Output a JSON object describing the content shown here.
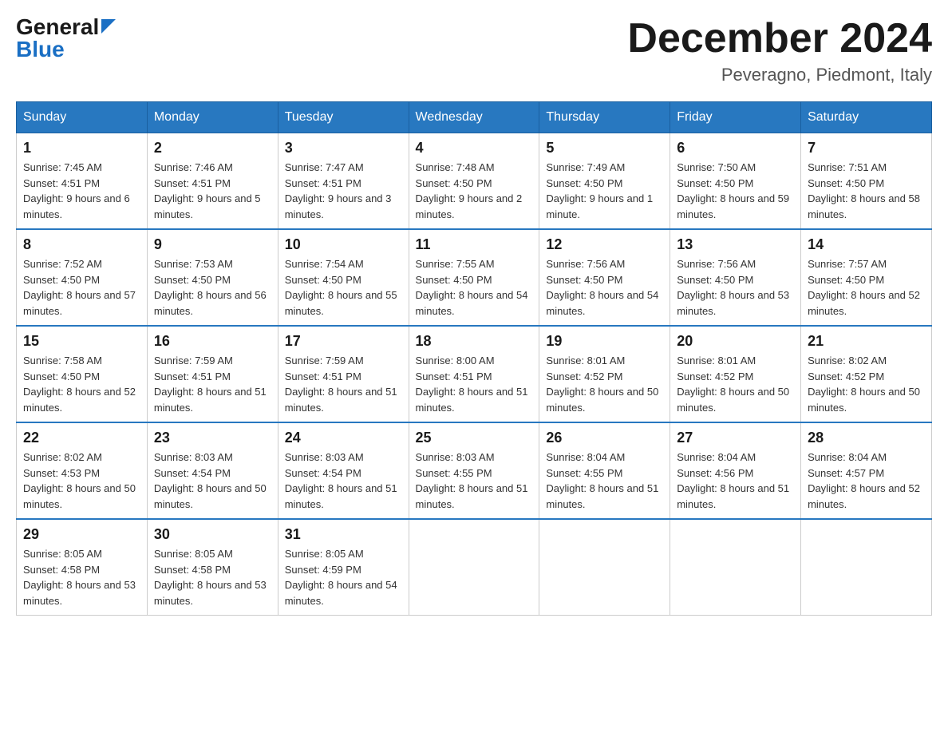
{
  "header": {
    "logo_general": "General",
    "logo_blue": "Blue",
    "month_title": "December 2024",
    "location": "Peveragno, Piedmont, Italy"
  },
  "days_of_week": [
    "Sunday",
    "Monday",
    "Tuesday",
    "Wednesday",
    "Thursday",
    "Friday",
    "Saturday"
  ],
  "weeks": [
    [
      {
        "day": "1",
        "sunrise": "7:45 AM",
        "sunset": "4:51 PM",
        "daylight": "9 hours and 6 minutes."
      },
      {
        "day": "2",
        "sunrise": "7:46 AM",
        "sunset": "4:51 PM",
        "daylight": "9 hours and 5 minutes."
      },
      {
        "day": "3",
        "sunrise": "7:47 AM",
        "sunset": "4:51 PM",
        "daylight": "9 hours and 3 minutes."
      },
      {
        "day": "4",
        "sunrise": "7:48 AM",
        "sunset": "4:50 PM",
        "daylight": "9 hours and 2 minutes."
      },
      {
        "day": "5",
        "sunrise": "7:49 AM",
        "sunset": "4:50 PM",
        "daylight": "9 hours and 1 minute."
      },
      {
        "day": "6",
        "sunrise": "7:50 AM",
        "sunset": "4:50 PM",
        "daylight": "8 hours and 59 minutes."
      },
      {
        "day": "7",
        "sunrise": "7:51 AM",
        "sunset": "4:50 PM",
        "daylight": "8 hours and 58 minutes."
      }
    ],
    [
      {
        "day": "8",
        "sunrise": "7:52 AM",
        "sunset": "4:50 PM",
        "daylight": "8 hours and 57 minutes."
      },
      {
        "day": "9",
        "sunrise": "7:53 AM",
        "sunset": "4:50 PM",
        "daylight": "8 hours and 56 minutes."
      },
      {
        "day": "10",
        "sunrise": "7:54 AM",
        "sunset": "4:50 PM",
        "daylight": "8 hours and 55 minutes."
      },
      {
        "day": "11",
        "sunrise": "7:55 AM",
        "sunset": "4:50 PM",
        "daylight": "8 hours and 54 minutes."
      },
      {
        "day": "12",
        "sunrise": "7:56 AM",
        "sunset": "4:50 PM",
        "daylight": "8 hours and 54 minutes."
      },
      {
        "day": "13",
        "sunrise": "7:56 AM",
        "sunset": "4:50 PM",
        "daylight": "8 hours and 53 minutes."
      },
      {
        "day": "14",
        "sunrise": "7:57 AM",
        "sunset": "4:50 PM",
        "daylight": "8 hours and 52 minutes."
      }
    ],
    [
      {
        "day": "15",
        "sunrise": "7:58 AM",
        "sunset": "4:50 PM",
        "daylight": "8 hours and 52 minutes."
      },
      {
        "day": "16",
        "sunrise": "7:59 AM",
        "sunset": "4:51 PM",
        "daylight": "8 hours and 51 minutes."
      },
      {
        "day": "17",
        "sunrise": "7:59 AM",
        "sunset": "4:51 PM",
        "daylight": "8 hours and 51 minutes."
      },
      {
        "day": "18",
        "sunrise": "8:00 AM",
        "sunset": "4:51 PM",
        "daylight": "8 hours and 51 minutes."
      },
      {
        "day": "19",
        "sunrise": "8:01 AM",
        "sunset": "4:52 PM",
        "daylight": "8 hours and 50 minutes."
      },
      {
        "day": "20",
        "sunrise": "8:01 AM",
        "sunset": "4:52 PM",
        "daylight": "8 hours and 50 minutes."
      },
      {
        "day": "21",
        "sunrise": "8:02 AM",
        "sunset": "4:52 PM",
        "daylight": "8 hours and 50 minutes."
      }
    ],
    [
      {
        "day": "22",
        "sunrise": "8:02 AM",
        "sunset": "4:53 PM",
        "daylight": "8 hours and 50 minutes."
      },
      {
        "day": "23",
        "sunrise": "8:03 AM",
        "sunset": "4:54 PM",
        "daylight": "8 hours and 50 minutes."
      },
      {
        "day": "24",
        "sunrise": "8:03 AM",
        "sunset": "4:54 PM",
        "daylight": "8 hours and 51 minutes."
      },
      {
        "day": "25",
        "sunrise": "8:03 AM",
        "sunset": "4:55 PM",
        "daylight": "8 hours and 51 minutes."
      },
      {
        "day": "26",
        "sunrise": "8:04 AM",
        "sunset": "4:55 PM",
        "daylight": "8 hours and 51 minutes."
      },
      {
        "day": "27",
        "sunrise": "8:04 AM",
        "sunset": "4:56 PM",
        "daylight": "8 hours and 51 minutes."
      },
      {
        "day": "28",
        "sunrise": "8:04 AM",
        "sunset": "4:57 PM",
        "daylight": "8 hours and 52 minutes."
      }
    ],
    [
      {
        "day": "29",
        "sunrise": "8:05 AM",
        "sunset": "4:58 PM",
        "daylight": "8 hours and 53 minutes."
      },
      {
        "day": "30",
        "sunrise": "8:05 AM",
        "sunset": "4:58 PM",
        "daylight": "8 hours and 53 minutes."
      },
      {
        "day": "31",
        "sunrise": "8:05 AM",
        "sunset": "4:59 PM",
        "daylight": "8 hours and 54 minutes."
      },
      null,
      null,
      null,
      null
    ]
  ]
}
